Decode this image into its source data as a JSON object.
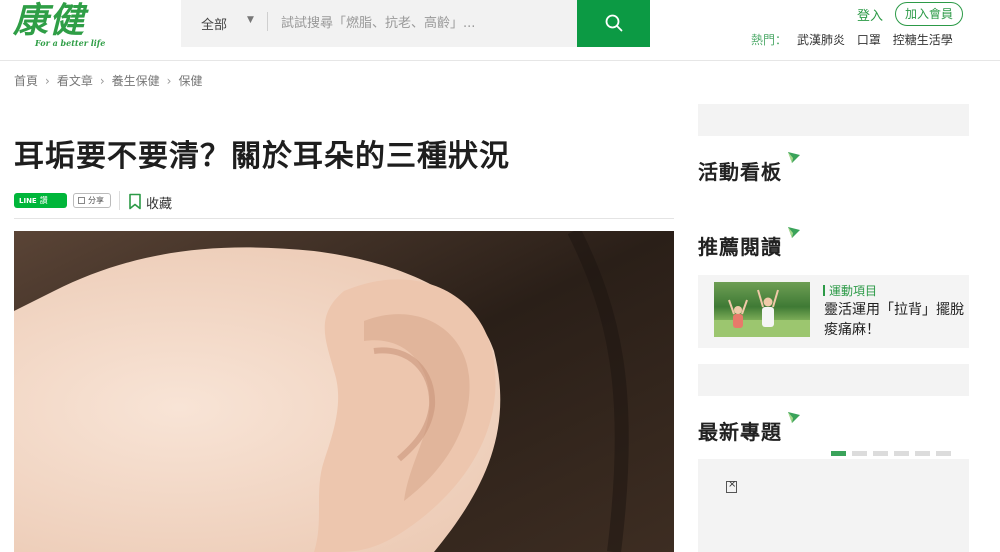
{
  "logo": {
    "main": "康健",
    "tagline": "For a better life"
  },
  "search": {
    "category": "全部",
    "placeholder": "試試搜尋「燃脂、抗老、高齡」..."
  },
  "account": {
    "login": "登入",
    "join": "加入會員"
  },
  "hot": {
    "label": "熱門：",
    "links": [
      "武漢肺炎",
      "口罩",
      "控糖生活學"
    ]
  },
  "breadcrumb": [
    "首頁",
    "看文章",
    "養生保健",
    "保健"
  ],
  "article": {
    "title": "耳垢要不要清？關於耳朵的三種狀況",
    "line_label": "讚",
    "share_label": "分享",
    "favorite_label": "收藏"
  },
  "sidebar": {
    "events_title": "活動看板",
    "recommended_title": "推薦閱讀",
    "recommended_item": {
      "category": "運動項目",
      "title": "靈活運用「拉背」擺脫痠痛麻！"
    },
    "latest_title": "最新專題",
    "carousel_dots": 6,
    "carousel_active": 0
  },
  "colors": {
    "brand_green": "#0c9a44",
    "accent_green": "#2c9a47"
  },
  "icons": [
    "search-icon",
    "caret-down-icon",
    "bookmark-icon",
    "line-icon",
    "share-icon",
    "flag-icon",
    "broken-image-icon"
  ]
}
